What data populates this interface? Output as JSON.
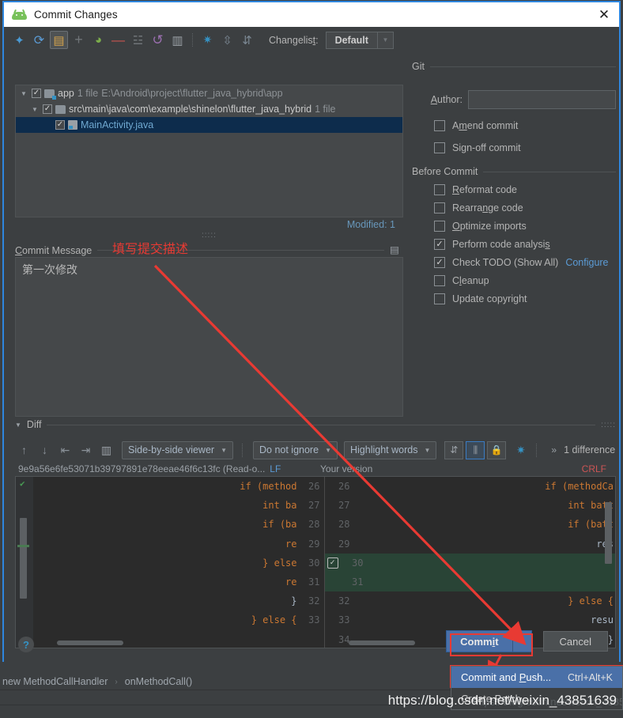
{
  "window": {
    "title": "Commit Changes",
    "app_icon": "android-icon",
    "close_icon": "✕"
  },
  "toolbar": {
    "icons": [
      "expand-all-icon",
      "refresh-icon",
      "show-diff-icon",
      "add-icon",
      "new-changelist-icon",
      "remove-icon",
      "group-by-icon",
      "revert-icon",
      "edit-source-icon",
      "settings-icon",
      "expand-icon",
      "collapse-icon"
    ],
    "changelist_label": "Changelist:",
    "changelist_value": "Default"
  },
  "file_tree": {
    "rows": [
      {
        "indent": 0,
        "twisty": "▼",
        "checked": true,
        "icon": "module-folder-icon",
        "name": "app",
        "meta": "1 file",
        "path": "E:\\Android\\project\\flutter_java_hybrid\\app",
        "selected": false
      },
      {
        "indent": 1,
        "twisty": "▼",
        "checked": true,
        "icon": "folder-icon",
        "name": "src\\main\\java\\com\\example\\shinelon\\flutter_java_hybrid",
        "meta": "1 file",
        "path": "",
        "selected": false
      },
      {
        "indent": 2,
        "twisty": "",
        "checked": true,
        "icon": "java-file-icon",
        "name": "MainActivity.java",
        "meta": "",
        "path": "",
        "selected": true
      }
    ],
    "modified_label": "Modified: 1"
  },
  "commit_message": {
    "section_title": "Commit Message",
    "value": "第一次修改",
    "history_icon": "commit-history-icon"
  },
  "git_panel": {
    "section_title": "Git",
    "author_label": "Author:",
    "author_value": "",
    "options": [
      {
        "label": "Amend commit",
        "checked": false
      },
      {
        "label": "Sign-off commit",
        "checked": false
      }
    ]
  },
  "before_commit": {
    "section_title": "Before Commit",
    "options": [
      {
        "label": "Reformat code",
        "checked": false,
        "link": ""
      },
      {
        "label": "Rearrange code",
        "checked": false,
        "link": ""
      },
      {
        "label": "Optimize imports",
        "checked": false,
        "link": ""
      },
      {
        "label": "Perform code analysis",
        "checked": true,
        "link": ""
      },
      {
        "label": "Check TODO (Show All)",
        "checked": true,
        "link": "Configure"
      },
      {
        "label": "Cleanup",
        "checked": false,
        "link": ""
      },
      {
        "label": "Update copyright",
        "checked": false,
        "link": ""
      }
    ]
  },
  "diff": {
    "section_title": "Diff",
    "viewer_mode": "Side-by-side viewer",
    "whitespace_mode": "Do not ignore",
    "highlight_mode": "Highlight words",
    "difference_count": "1 difference",
    "left_title": "9e9a56e6fe53071b39797891e78eeae46f6c13fc (Read-o...",
    "left_line_ending": "LF",
    "right_title": "Your version",
    "right_line_ending": "CRLF",
    "left_lines": [
      {
        "num": "26",
        "code": "if (method"
      },
      {
        "num": "27",
        "code": "int ba"
      },
      {
        "num": "28",
        "code": "if (ba"
      },
      {
        "num": "29",
        "code": "re"
      },
      {
        "num": "30",
        "code": "} else"
      },
      {
        "num": "31",
        "code": "re"
      },
      {
        "num": "32",
        "code": "}"
      },
      {
        "num": "33",
        "code": "} else {"
      }
    ],
    "right_lines": [
      {
        "num": "26",
        "code": "if (methodCa"
      },
      {
        "num": "27",
        "code": "int batt"
      },
      {
        "num": "28",
        "code": "if (batt"
      },
      {
        "num": "29",
        "code": "res"
      },
      {
        "num": "30",
        "code": "",
        "added": true
      },
      {
        "num": "31",
        "code": "",
        "added": true
      },
      {
        "num": "32",
        "code": "} else {"
      },
      {
        "num": "33",
        "code": "resu"
      },
      {
        "num": "34",
        "code": "}"
      }
    ]
  },
  "buttons": {
    "commit": "Commit",
    "commit_dropdown_icon": "chevron-down-icon",
    "cancel": "Cancel",
    "help": "?"
  },
  "popup_menu": {
    "items": [
      {
        "label": "Commit and Push...",
        "shortcut": "Ctrl+Alt+K",
        "selected": true
      },
      {
        "label": "Create Patch...",
        "shortcut": "",
        "selected": false
      }
    ]
  },
  "breadcrumb": {
    "items": [
      "new MethodCallHandler",
      "onMethodCall()"
    ],
    "separator": "›"
  },
  "annotations": {
    "note_text": "填写提交描述",
    "arrow_color": "#e83a33"
  },
  "watermark": {
    "text": "https://blog.csdn.net/weixin_43851639"
  },
  "colors": {
    "accent_blue": "#4a70a8",
    "window_border": "#2e86de",
    "panel_bg": "#3c3f41",
    "field_bg": "#45484a",
    "link": "#5b9bd5",
    "added_diff": "#294436",
    "annotation_red": "#e83a33"
  }
}
